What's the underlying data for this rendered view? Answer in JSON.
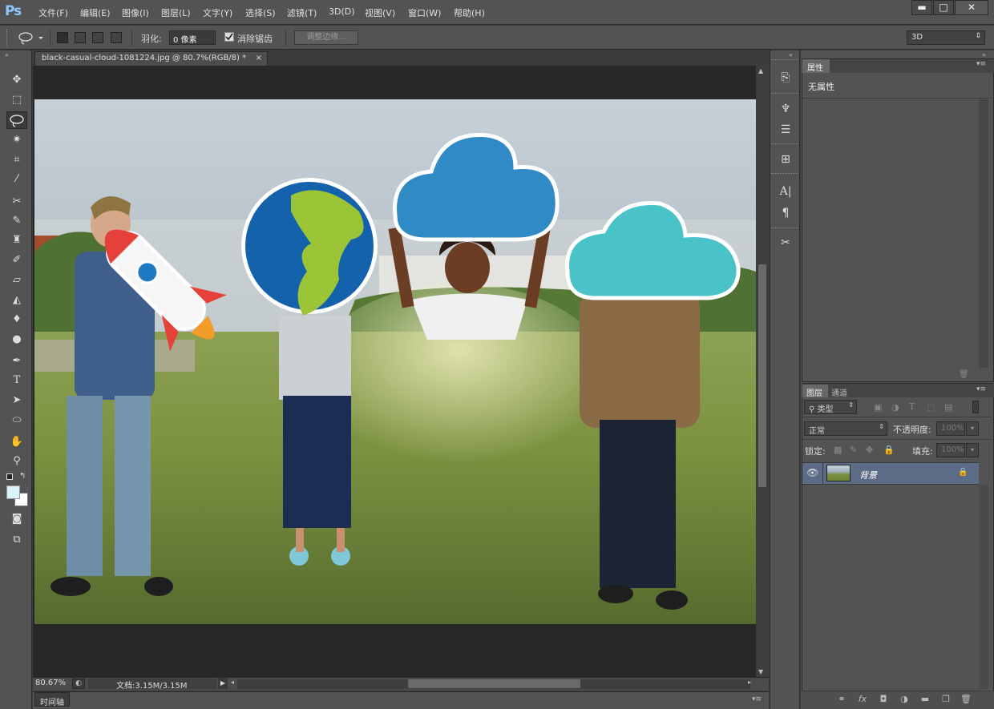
{
  "app": {
    "logo": "Ps"
  },
  "menu": [
    "文件(F)",
    "编辑(E)",
    "图像(I)",
    "图层(L)",
    "文字(Y)",
    "选择(S)",
    "滤镜(T)",
    "3D(D)",
    "视图(V)",
    "窗口(W)",
    "帮助(H)"
  ],
  "window_buttons": {
    "minimize": "▬",
    "maximize": "□",
    "close": "✕"
  },
  "options": {
    "feather_label": "羽化:",
    "feather_value": "0 像素",
    "antialias_label": "消除锯齿",
    "antialias_checked": true,
    "refine_edge": "调整边缘...",
    "workspace": "3D"
  },
  "document": {
    "tab_title": "black-casual-cloud-1081224.jpg @ 80.7%(RGB/8) *",
    "zoom": "80.67%",
    "doc_info": "文档:3.15M/3.15M"
  },
  "timeline": {
    "label": "时间轴"
  },
  "properties": {
    "tab": "属性",
    "empty_text": "无属性"
  },
  "layers": {
    "tabs": [
      "图层",
      "通道"
    ],
    "filter_kind": "类型",
    "blend_mode": "正常",
    "opacity_label": "不透明度:",
    "opacity_value": "100%",
    "lock_label": "锁定:",
    "fill_label": "填充:",
    "fill_value": "100%",
    "items": [
      {
        "name": "背景",
        "visible": true,
        "locked": true
      }
    ]
  },
  "icons": {
    "tools": [
      "move-icon",
      "marquee-icon",
      "lasso-icon",
      "magic-wand-icon",
      "crop-icon",
      "eyedropper-icon",
      "healing-brush-icon",
      "brush-icon",
      "clone-stamp-icon",
      "history-brush-icon",
      "eraser-icon",
      "paint-bucket-icon",
      "blur-icon",
      "dodge-icon",
      "pen-icon",
      "type-icon",
      "path-select-icon",
      "ellipse-icon",
      "hand-icon",
      "zoom-icon"
    ]
  },
  "colors": {
    "foreground": "#d9f3fb",
    "background": "#ffffff",
    "accent": "#5c6b86"
  }
}
